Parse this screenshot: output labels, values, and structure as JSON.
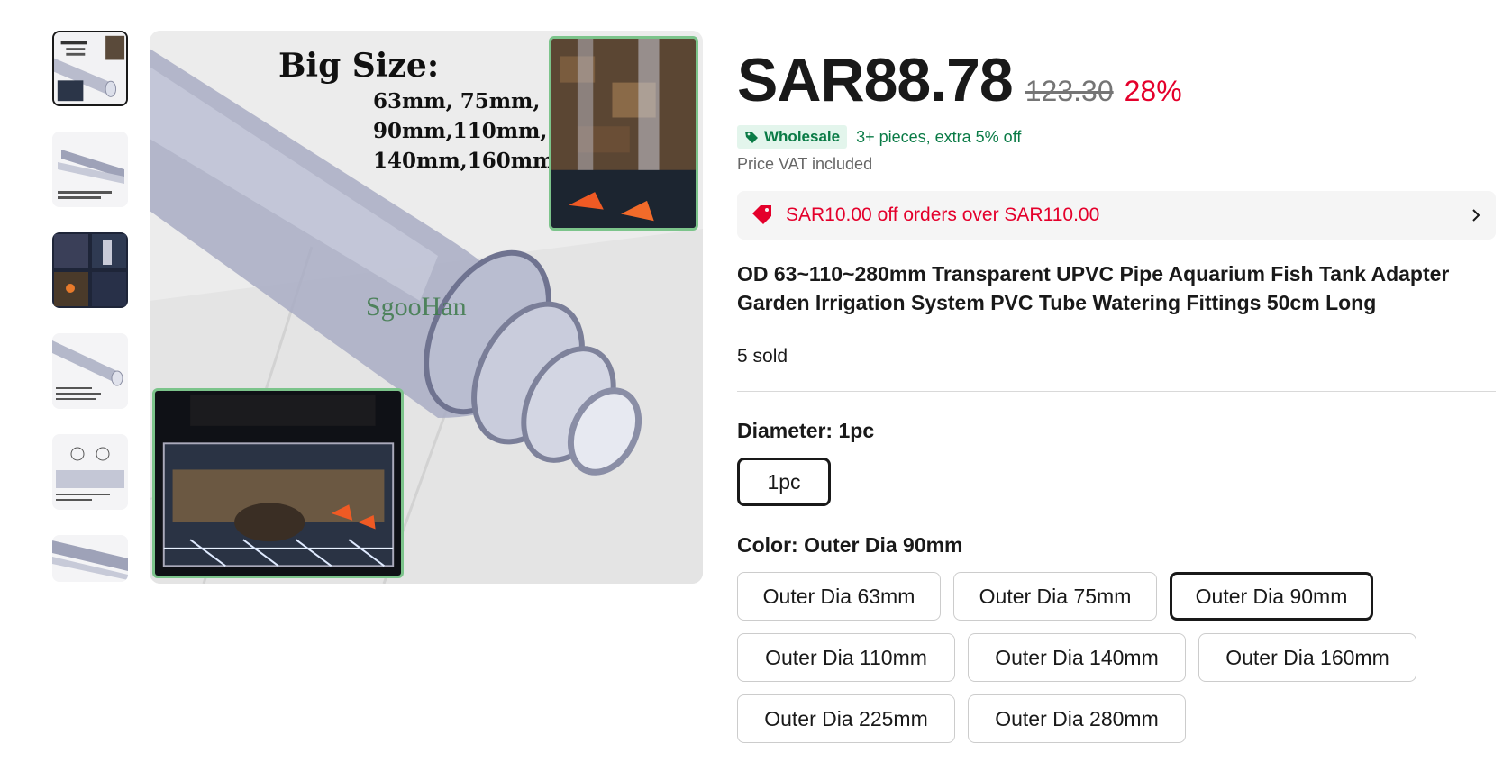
{
  "gallery": {
    "thumbnails": [
      {
        "alt": "thumbnail-1"
      },
      {
        "alt": "thumbnail-2"
      },
      {
        "alt": "thumbnail-3"
      },
      {
        "alt": "thumbnail-4"
      },
      {
        "alt": "thumbnail-5"
      },
      {
        "alt": "thumbnail-6"
      }
    ],
    "main_image": {
      "headline": "Big Size:",
      "sizes": "63mm, 75mm, 90mm,110mm, 140mm,160mm",
      "brand": "SgooHan"
    }
  },
  "price": {
    "current": "SAR88.78",
    "original": "123.30",
    "discount": "28%"
  },
  "wholesale": {
    "badge": "Wholesale",
    "text": "3+ pieces, extra 5% off"
  },
  "vat_note": "Price VAT included",
  "coupon": {
    "text": "SAR10.00 off orders over SAR110.00"
  },
  "product": {
    "title": "OD 63~110~280mm Transparent UPVC Pipe Aquarium Fish Tank Adapter Garden Irrigation System PVC Tube Watering Fittings 50cm Long",
    "sold": "5 sold"
  },
  "diameter": {
    "label": "Diameter: ",
    "value": "1pc",
    "options": [
      "1pc"
    ]
  },
  "color": {
    "label": "Color: ",
    "value": "Outer Dia 90mm",
    "options": [
      "Outer Dia 63mm",
      "Outer Dia 75mm",
      "Outer Dia 90mm",
      "Outer Dia 110mm",
      "Outer Dia 140mm",
      "Outer Dia 160mm",
      "Outer Dia 225mm",
      "Outer Dia 280mm"
    ]
  },
  "colors": {
    "price_red": "#e4002b",
    "wholesale_green": "#0a7b46",
    "text": "#191919"
  }
}
